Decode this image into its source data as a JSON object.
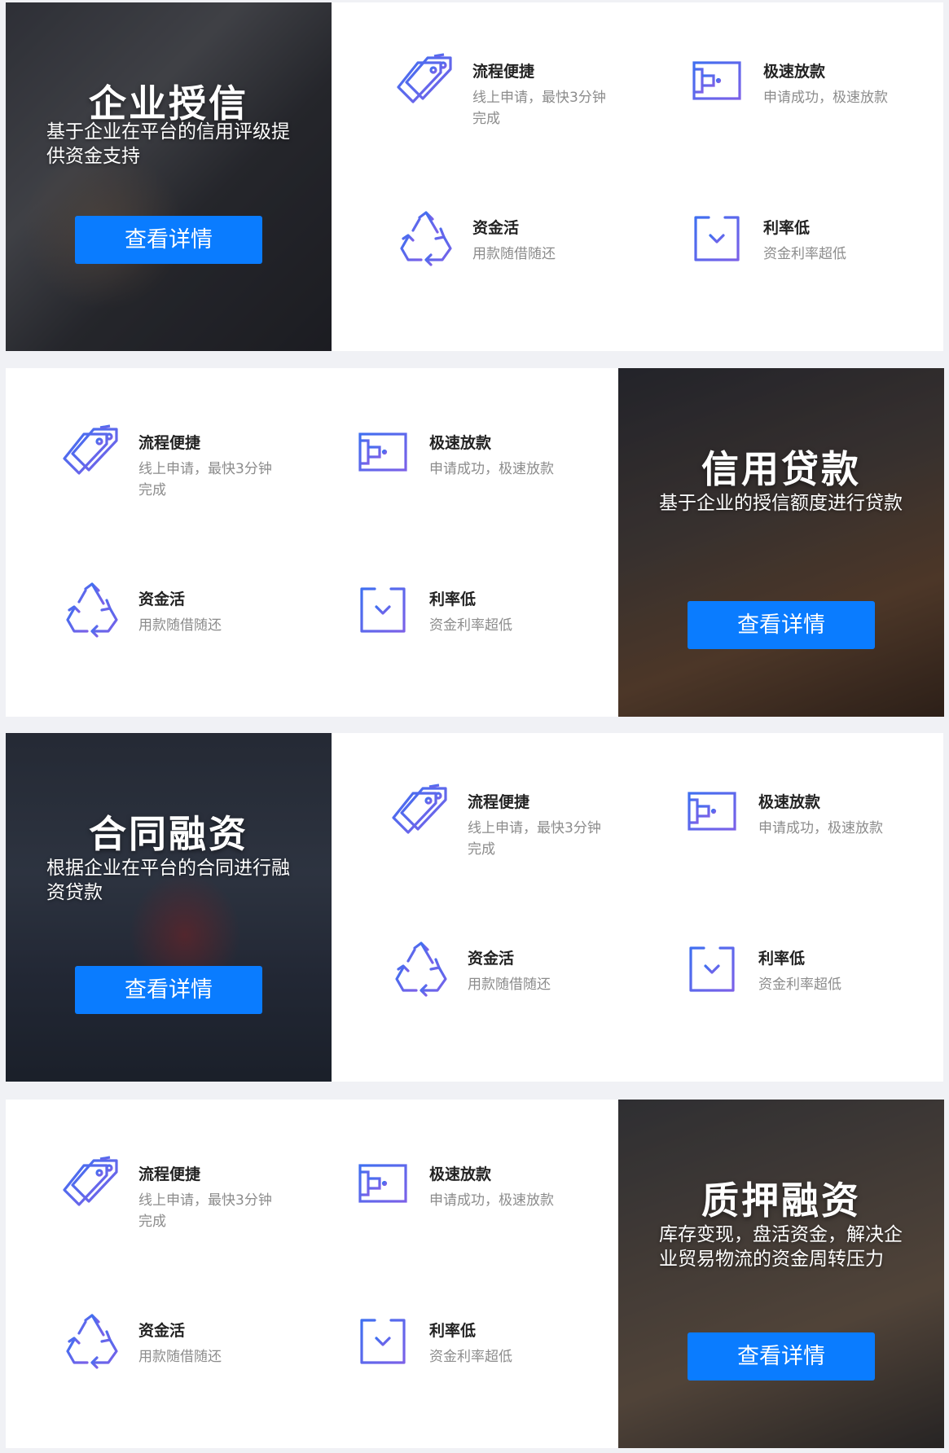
{
  "features": [
    {
      "key": "fast",
      "title": "流程便捷",
      "desc": "线上申请，最快3分钟完成",
      "icon": "tags-icon"
    },
    {
      "key": "loan",
      "title": "极速放款",
      "desc": "申请成功，极速放款",
      "icon": "card-icon"
    },
    {
      "key": "flex",
      "title": "资金活",
      "desc": "用款随借随还",
      "icon": "recycle-icon"
    },
    {
      "key": "rate",
      "title": "利率低",
      "desc": "资金利率超低",
      "icon": "download-box-icon"
    }
  ],
  "sections": [
    {
      "title": "企业授信",
      "desc": "基于企业在平台的信用评级提供资金支持",
      "button": "查看详情"
    },
    {
      "title": "信用贷款",
      "desc": "基于企业的授信额度进行贷款",
      "button": "查看详情"
    },
    {
      "title": "合同融资",
      "desc": "根据企业在平台的合同进行融资贷款",
      "button": "查看详情"
    },
    {
      "title": "质押融资",
      "desc": "库存变现，盘活资金，解决企业贸易物流的资金周转压力",
      "button": "查看详情"
    }
  ],
  "colors": {
    "accent": "#0a7cff",
    "icon_start": "#3f6ff0",
    "icon_end": "#7b61e8"
  }
}
